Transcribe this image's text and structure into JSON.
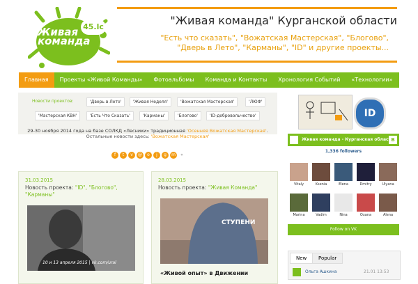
{
  "header": {
    "logo_text_line1": "Живая",
    "logo_text_line2": "команда",
    "logo_badge": "45.lc",
    "title": "\"Живая команда\" Курганской области",
    "subtitle_line1": "\"Есть что сказать\", \"Вожатская Мастерская\", \"Блогово\",",
    "subtitle_line2": "\"Дверь в Лето\", \"Карманы\", \"ID\" и другие проекты..."
  },
  "nav": [
    "Главная",
    "Проекты «Живой Команды»",
    "Фотоальбомы",
    "Команда и Контакты",
    "Хронология Событий",
    "«Технологии»"
  ],
  "projects": {
    "label": "Новости проектов:",
    "chips": [
      "'Дверь в Лето'",
      "'Живая Неделя'",
      "'Вожатская Мастерская'",
      "'ЛЮФ'",
      "'Мастерская КВН'",
      "'Есть Что Сказать'",
      "'Карманы'",
      "'Блогово'",
      "'ID-добровольчество'"
    ]
  },
  "news": {
    "line1_prefix": "29-30 ноября 2014 года на базе СОЛКД «Лесники» традиционная ",
    "line1_link": "'Осенняя Вожатская Мастерская'",
    "line1_suffix": ".",
    "line2_prefix": "Остальные новости здесь: ",
    "line2_link": "'Вожатская Мастерская'"
  },
  "posts": [
    {
      "date": "31.03.2015",
      "prefix": "Новость проекта: ",
      "link": "\"ID\", \"Блогово\", \"Карманы\"",
      "img_caption": "10 и 13 апреля 2015 | vk.com/ural"
    },
    {
      "date": "28.03.2015",
      "prefix": "Новость проекта: ",
      "link": "\"Живая Команда\"",
      "headline": "«Живой опыт» в Движении",
      "img_caption": "СТУПЕНИ"
    }
  ],
  "sidebar": {
    "id_logo": "ID",
    "vk_group": "Живая команда - Курганская область",
    "vk_badge": "B",
    "followers": "1,336 followers",
    "people": [
      "Vitaly",
      "Ksenia",
      "Elena",
      "Dmitry",
      "Ulyana",
      "Marina",
      "Vadim",
      "Nina",
      "Oxana",
      "Alena"
    ],
    "follow_btn": "Follow on VK",
    "tabs": [
      "New",
      "Popular"
    ],
    "latest_author": "Ольга Ашкина",
    "latest_time": "21.01 13:53"
  },
  "colors": {
    "brand_green": "#7cbf1e",
    "brand_orange": "#f39c12"
  }
}
